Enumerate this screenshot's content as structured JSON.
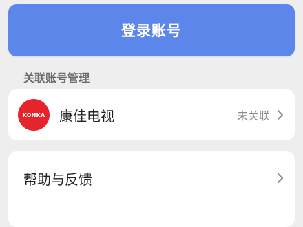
{
  "login": {
    "label": "登录账号"
  },
  "linked_accounts": {
    "title": "关联账号管理",
    "items": [
      {
        "logo_text": "KONKA",
        "name": "康佳电视",
        "status": "未关联",
        "logo_color": "#e5242b"
      }
    ]
  },
  "help": {
    "label": "帮助与反馈"
  },
  "colors": {
    "accent": "#5c86ea",
    "background": "#eeeeef",
    "card": "#ffffff"
  },
  "icons": {
    "chevron": "chevron-right-icon"
  }
}
